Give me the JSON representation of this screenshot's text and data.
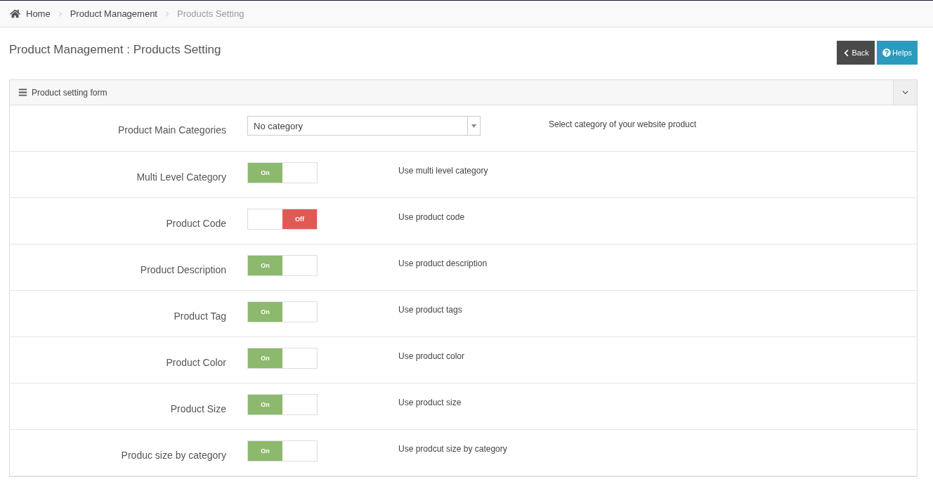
{
  "breadcrumb": [
    {
      "label": "Home",
      "current": false
    },
    {
      "label": "Product Management",
      "current": false
    },
    {
      "label": "Products Setting",
      "current": true
    }
  ],
  "page_title": "Product Management : Products Setting",
  "buttons": [
    {
      "kind": "back",
      "label": "Back"
    },
    {
      "kind": "help",
      "label": "Helps"
    }
  ],
  "panel": {
    "title": "Product setting form",
    "expanded": true
  },
  "rows": [
    {
      "kind": "select",
      "label": "Product Main Categories",
      "value": "No category",
      "help": "Select category of your website product"
    },
    {
      "kind": "toggle",
      "label": "Multi Level Category",
      "on": true,
      "state_label": "On",
      "help": "Use multi level category"
    },
    {
      "kind": "toggle",
      "label": "Product Code",
      "on": false,
      "state_label": "Off",
      "help": "Use product code"
    },
    {
      "kind": "toggle",
      "label": "Product Description",
      "on": true,
      "state_label": "On",
      "help": "Use product description"
    },
    {
      "kind": "toggle",
      "label": "Product Tag",
      "on": true,
      "state_label": "On",
      "help": "Use product tags"
    },
    {
      "kind": "toggle",
      "label": "Product Color",
      "on": true,
      "state_label": "On",
      "help": "Use product color"
    },
    {
      "kind": "toggle",
      "label": "Product Size",
      "on": true,
      "state_label": "On",
      "help": "Use product size"
    },
    {
      "kind": "toggle",
      "label": "Produc size by category",
      "on": true,
      "state_label": "On",
      "help": "Use prodcut size by category"
    }
  ]
}
